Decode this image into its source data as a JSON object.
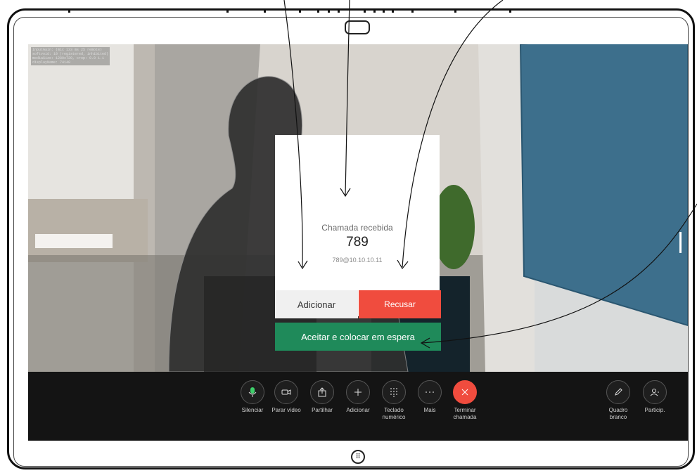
{
  "debug_overlay": "inputGain: (mic 133 ms 25 remote)\nsoftvoid: 10 (registered, inhibited)\nmediaSize: 1280x720, crop: 0.0 1.1\ndisplayName: 74140",
  "incoming_call": {
    "title": "Chamada recebida",
    "number": "789",
    "address": "789@10.10.10.11"
  },
  "buttons": {
    "add": "Adicionar",
    "decline": "Recusar",
    "accept_hold": "Aceitar e colocar em espera"
  },
  "toolbar": {
    "items": [
      {
        "icon": "microphone-icon",
        "label": "Silenciar"
      },
      {
        "icon": "video-camera-icon",
        "label": "Parar vídeo"
      },
      {
        "icon": "share-icon",
        "label": "Partilhar"
      },
      {
        "icon": "plus-icon",
        "label": "Adicionar"
      },
      {
        "icon": "keypad-icon",
        "label": "Teclado\nnumérico"
      },
      {
        "icon": "more-icon",
        "label": "Mais"
      },
      {
        "icon": "end-call-icon",
        "label": "Terminar\nchamada"
      }
    ],
    "right_items": [
      {
        "icon": "whiteboard-pen-icon",
        "label": "Quadro\nbranco"
      },
      {
        "icon": "participants-icon",
        "label": "Particip."
      }
    ]
  },
  "colors": {
    "decline": "#f04c3e",
    "accept": "#1f8a5a",
    "end_call": "#f04c3e",
    "mic_active": "#3ecf6a",
    "toolbar_bg": "#141414"
  }
}
